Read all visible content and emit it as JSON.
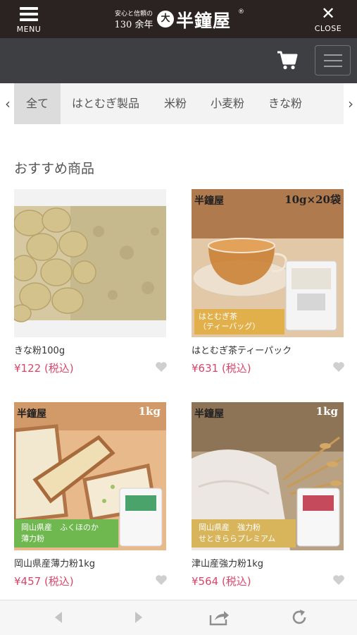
{
  "header": {
    "menu_label": "MENU",
    "close_label": "CLOSE",
    "brand_tagline_line1": "安心と信頼の",
    "brand_tagline_line2": "130 余年",
    "brand_seal": "大",
    "brand_name": "半鐘屋",
    "brand_reg": "®"
  },
  "categories": {
    "items": [
      "全て",
      "はとむぎ製品",
      "米粉",
      "小麦粉",
      "きな粉"
    ],
    "active_index": 0,
    "prev_arrow": "‹",
    "next_arrow": "›"
  },
  "section": {
    "title": "おすすめ商品"
  },
  "products": [
    {
      "name": "きな粉100g",
      "price": "¥122 (税込)",
      "image": "kinako-soybeans"
    },
    {
      "name": "はとむぎ茶ティーパック",
      "price": "¥631 (税込)",
      "image": "hatomugi-tea",
      "badge": "10g×20袋",
      "brand": "半鐘屋",
      "banner_line1": "はとむぎ茶",
      "banner_line2": "（ティーバッグ）"
    },
    {
      "name": "岡山県産薄力粉1kg",
      "price": "¥457 (税込)",
      "image": "pound-cake",
      "badge": "1kg",
      "brand": "半鐘屋",
      "banner_line1": "岡山県産　ふくほのか",
      "banner_line2": "薄力粉"
    },
    {
      "name": "津山産強力粉1kg",
      "price": "¥564 (税込)",
      "image": "flour-wheat",
      "badge": "1kg",
      "brand": "半鐘屋",
      "banner_line1": "岡山県産　強力粉",
      "banner_line2": "せときららプレミアム"
    }
  ],
  "colors": {
    "header_bg": "#2b2321",
    "subbar_bg": "#3d3f42",
    "price": "#d8456a"
  },
  "icons": [
    "menu-icon",
    "close-icon",
    "cart-icon",
    "hamburger-icon",
    "heart-icon",
    "back-icon",
    "forward-icon",
    "share-icon",
    "reload-icon"
  ]
}
